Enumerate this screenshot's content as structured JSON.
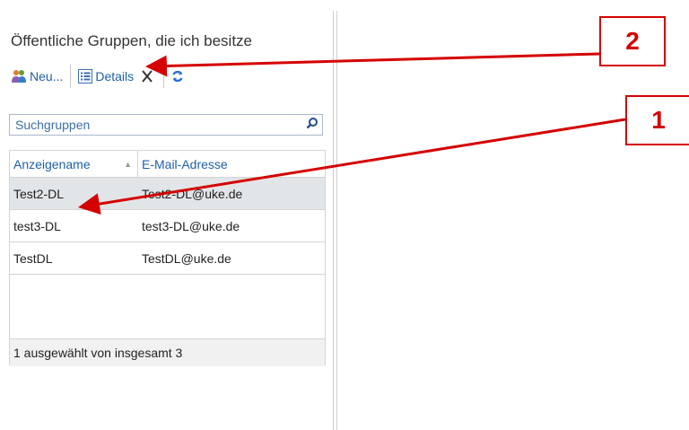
{
  "panel": {
    "title": "Öffentliche Gruppen, die ich besitze"
  },
  "toolbar": {
    "new_label": "Neu...",
    "details_label": "Details",
    "new_icon": "group-icon",
    "details_icon": "details-list-icon",
    "delete_icon": "close-icon",
    "refresh_icon": "refresh-icon"
  },
  "search": {
    "placeholder": "Suchgruppen",
    "icon": "search-icon"
  },
  "grid": {
    "columns": [
      "Anzeigename",
      "E-Mail-Adresse"
    ],
    "rows": [
      {
        "name": "Test2-DL",
        "email": "Test2-DL@uke.de"
      },
      {
        "name": "test3-DL",
        "email": "test3-DL@uke.de"
      },
      {
        "name": "TestDL",
        "email": "TestDL@uke.de"
      }
    ],
    "selected_index": 0,
    "footer": "1 ausgewählt von insgesamt 3"
  },
  "annotations": {
    "label_1": "1",
    "label_2": "2",
    "color": "#d50000"
  },
  "colors": {
    "link": "#1f5fa8",
    "selection": "#e1e5e8"
  }
}
